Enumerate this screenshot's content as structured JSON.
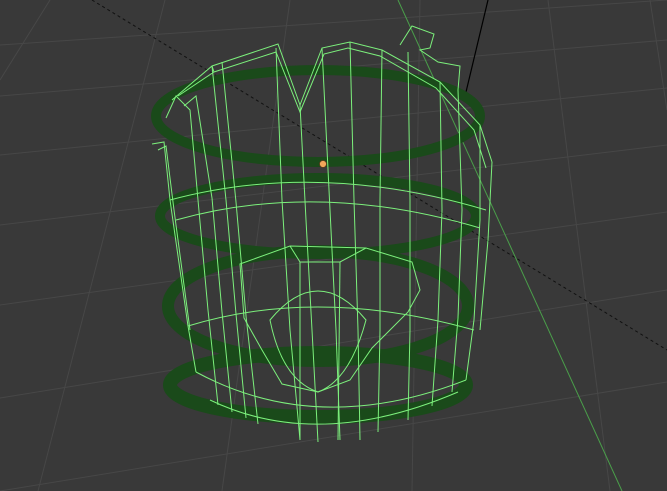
{
  "viewport": {
    "mode": "wireframe",
    "object": "barrel-mesh",
    "colors": {
      "background": "#393939",
      "grid": "#474747",
      "edge_selected": "#7CF07C",
      "edge_dim": "#1A4A1A",
      "axis_y": "#4A9E4A",
      "axis_z": "#000000",
      "origin": "#F2A65A"
    }
  }
}
